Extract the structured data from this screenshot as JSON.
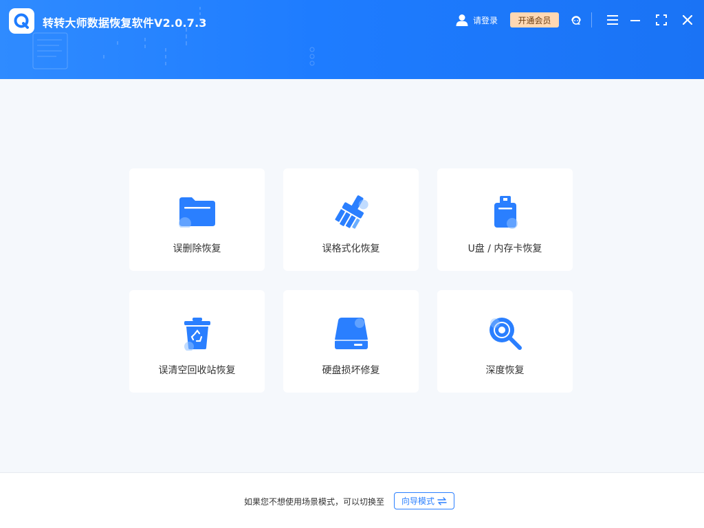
{
  "header": {
    "title": "转转大师数据恢复软件V2.0.7.3",
    "login_label": "请登录",
    "vip_label": "开通会员",
    "icons": [
      "user-icon",
      "support-icon",
      "menu-icon",
      "minimize-icon",
      "maximize-icon",
      "close-icon"
    ]
  },
  "cards": [
    {
      "label": "误删除恢复",
      "icon": "folder-icon"
    },
    {
      "label": "误格式化恢复",
      "icon": "broom-icon"
    },
    {
      "label": "U盘 / 内存卡恢复",
      "icon": "usb-drive-icon"
    },
    {
      "label": "误清空回收站恢复",
      "icon": "recycle-bin-icon"
    },
    {
      "label": "硬盘损坏修复",
      "icon": "hard-disk-icon"
    },
    {
      "label": "深度恢复",
      "icon": "deep-scan-icon"
    }
  ],
  "footer": {
    "prompt": "如果您不想使用场景模式，可以切换至",
    "guide_label": "向导模式"
  },
  "colors": {
    "header_blue": "#1e7cff",
    "accent": "#2a7fff",
    "vip_bg": "#ffd8b3",
    "page_bg": "#f5f8fc"
  }
}
